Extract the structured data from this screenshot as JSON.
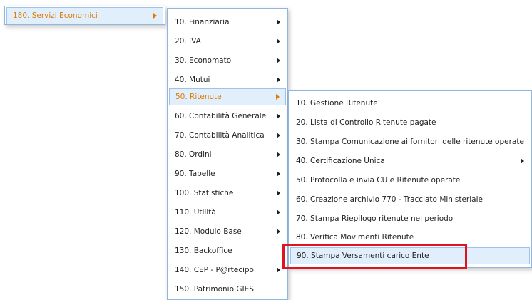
{
  "menu_level1": {
    "items": [
      {
        "label": "180. Servizi Economici",
        "has_submenu": true,
        "active": true
      }
    ]
  },
  "menu_level2": {
    "items": [
      {
        "label": "10. Finanziaria",
        "has_submenu": true
      },
      {
        "label": "20. IVA",
        "has_submenu": true
      },
      {
        "label": "30. Economato",
        "has_submenu": true
      },
      {
        "label": "40. Mutui",
        "has_submenu": true
      },
      {
        "label": "50. Ritenute",
        "has_submenu": true,
        "active": true
      },
      {
        "label": "60. Contabilità Generale",
        "has_submenu": true
      },
      {
        "label": "70. Contabilità Analitica",
        "has_submenu": true
      },
      {
        "label": "80. Ordini",
        "has_submenu": true
      },
      {
        "label": "90. Tabelle",
        "has_submenu": true
      },
      {
        "label": "100. Statistiche",
        "has_submenu": true
      },
      {
        "label": "110. Utilità",
        "has_submenu": true
      },
      {
        "label": "120. Modulo Base",
        "has_submenu": true
      },
      {
        "label": "130. Backoffice",
        "has_submenu": false
      },
      {
        "label": "140. CEP - P@rtecipo",
        "has_submenu": true
      },
      {
        "label": "150. Patrimonio GIES",
        "has_submenu": false
      }
    ]
  },
  "menu_level3": {
    "items": [
      {
        "label": "10. Gestione Ritenute",
        "has_submenu": false
      },
      {
        "label": "20. Lista di Controllo Ritenute pagate",
        "has_submenu": false
      },
      {
        "label": "30. Stampa Comunicazione ai fornitori delle ritenute operate",
        "has_submenu": false
      },
      {
        "label": "40. Certificazione Unica",
        "has_submenu": true
      },
      {
        "label": "50. Protocolla e invia CU e Ritenute operate",
        "has_submenu": false
      },
      {
        "label": "60. Creazione archivio 770 - Tracciato Ministeriale",
        "has_submenu": false
      },
      {
        "label": "70. Stampa Riepilogo ritenute nel periodo",
        "has_submenu": false
      },
      {
        "label": "80. Verifica Movimenti Ritenute",
        "has_submenu": false
      },
      {
        "label": "90. Stampa Versamenti carico Ente",
        "has_submenu": false,
        "hovered": true
      }
    ]
  },
  "colors": {
    "active_text": "#e07b00",
    "highlight_bg": "#e1eefb",
    "highlight_border": "#9fc2e6",
    "menu_border": "#8fb6de",
    "annotation_box": "#e0141c"
  }
}
